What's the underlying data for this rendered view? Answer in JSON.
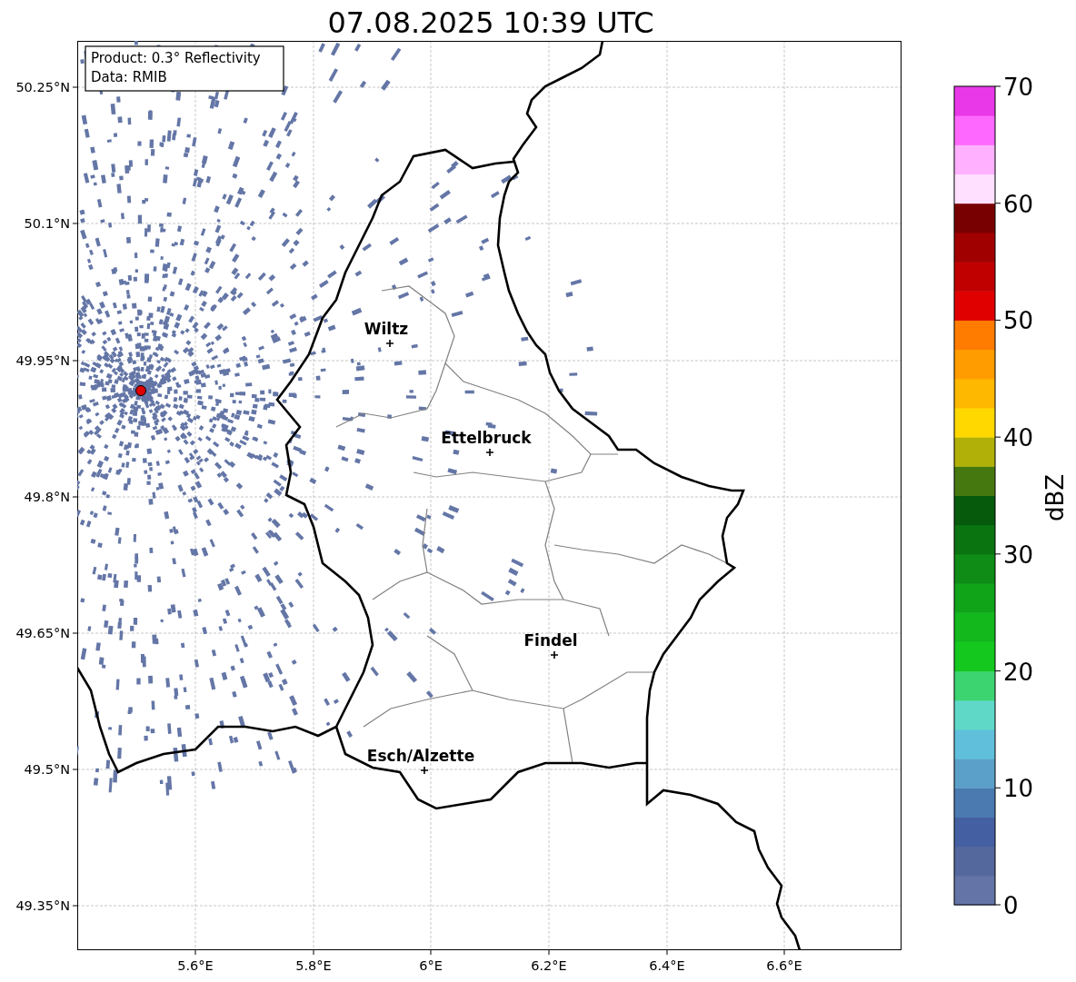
{
  "title": "07.08.2025 10:39 UTC",
  "info_box": {
    "lines": [
      "Product: 0.3° Reflectivity",
      "Data: RMIB"
    ]
  },
  "map": {
    "y_ticks": [
      "50.25°N",
      "50.1°N",
      "49.95°N",
      "49.8°N",
      "49.65°N",
      "49.5°N",
      "49.35°N"
    ],
    "x_ticks": [
      "5.6°E",
      "5.8°E",
      "6°E",
      "6.2°E",
      "6.4°E",
      "6.6°E"
    ],
    "cities": [
      {
        "name": "Wiltz"
      },
      {
        "name": "Ettelbruck"
      },
      {
        "name": "Findel"
      },
      {
        "name": "Esch/Alzette"
      }
    ]
  },
  "colorbar": {
    "label": "dBZ",
    "ticks": [
      "70",
      "60",
      "50",
      "40",
      "30",
      "20",
      "10",
      "0"
    ],
    "segments": [
      {
        "color": "#6474a6"
      },
      {
        "color": "#55689e"
      },
      {
        "color": "#4560a2"
      },
      {
        "color": "#4a7ab0"
      },
      {
        "color": "#5aa0c8"
      },
      {
        "color": "#60c0dc"
      },
      {
        "color": "#60d8c8"
      },
      {
        "color": "#3cd470"
      },
      {
        "color": "#14c81e"
      },
      {
        "color": "#12b81c"
      },
      {
        "color": "#10a418"
      },
      {
        "color": "#0e8c16"
      },
      {
        "color": "#0a7410"
      },
      {
        "color": "#065a0c"
      },
      {
        "color": "#467810"
      },
      {
        "color": "#b0b008"
      },
      {
        "color": "#ffd800"
      },
      {
        "color": "#ffb800"
      },
      {
        "color": "#ff9c00"
      },
      {
        "color": "#ff7c00"
      },
      {
        "color": "#e00000"
      },
      {
        "color": "#c00000"
      },
      {
        "color": "#a00000"
      },
      {
        "color": "#780000"
      },
      {
        "color": "#ffe0ff"
      },
      {
        "color": "#ffb0ff"
      },
      {
        "color": "#ff68ff"
      },
      {
        "color": "#e838e8"
      }
    ]
  }
}
